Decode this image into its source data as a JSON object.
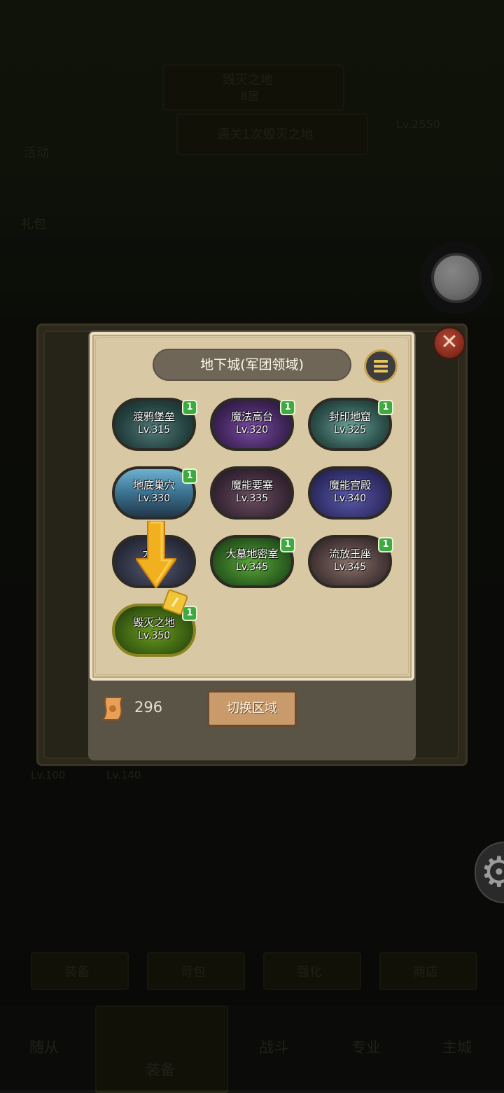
{
  "panel": {
    "title": "地下城(军团领域)",
    "scroll_count": "296",
    "switch_button": "切换区域"
  },
  "dungeons": [
    {
      "name": "渡鸦堡垒",
      "level": "Lv.315",
      "badge": "1"
    },
    {
      "name": "魔法高台",
      "level": "Lv.320",
      "badge": "1"
    },
    {
      "name": "封印地窟",
      "level": "Lv.325",
      "badge": "1"
    },
    {
      "name": "地底巢穴",
      "level": "Lv.330",
      "badge": "1"
    },
    {
      "name": "魔能要塞",
      "level": "Lv.335",
      "badge": ""
    },
    {
      "name": "魔能宫殿",
      "level": "Lv.340",
      "badge": ""
    },
    {
      "name": "大   殿",
      "level": "",
      "badge": ""
    },
    {
      "name": "大墓地密室",
      "level": "Lv.345",
      "badge": "1"
    },
    {
      "name": "流放王座",
      "level": "Lv.345",
      "badge": "1"
    },
    {
      "name": "毁灭之地",
      "level": "Lv.350",
      "badge": "1"
    }
  ],
  "background": {
    "top_banner_line1": "毁灭之地",
    "top_banner_line2": "8层",
    "quest_text": "通关1次毁灭之地",
    "left_label": "活动",
    "left_label2": "礼包",
    "power_text": "Lv.2550",
    "slot_labels": [
      "Lv.100",
      "Lv.140"
    ],
    "tabs": [
      "装备",
      "背包",
      "强化",
      "商店"
    ],
    "nav": [
      "随从",
      "装备",
      "战斗",
      "专业",
      "主城"
    ]
  },
  "colors": {
    "parchment": "#d8c8a4",
    "panel": "#5a5447",
    "badge_green": "#3ea940",
    "close_red": "#9c3a2a",
    "arrow_yellow": "#f0b020"
  }
}
